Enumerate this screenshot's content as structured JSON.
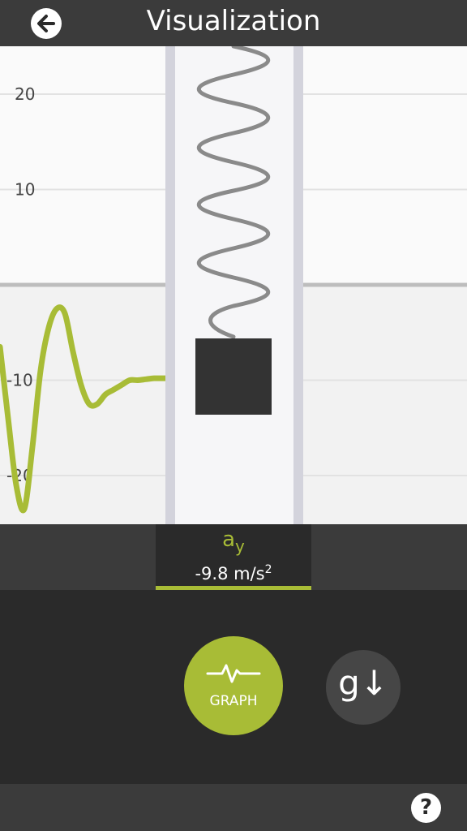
{
  "header": {
    "title": "Visualization",
    "back_icon": "arrow-left-icon"
  },
  "chart_data": {
    "type": "line",
    "y_tick_labels": [
      "20",
      "10",
      "-10",
      "-20"
    ],
    "y_ticks": [
      20,
      10,
      0,
      -10,
      -20
    ],
    "ylim": [
      -25,
      25
    ],
    "grid": true,
    "series": [
      {
        "color": "#a8bc36",
        "x": [
          0,
          0.5,
          1,
          1.5,
          2,
          2.5,
          3,
          3.5,
          4,
          4.5,
          5,
          5.5,
          6,
          6.5,
          7,
          7.5,
          8,
          8.5,
          9,
          9.5,
          10,
          10.5
        ],
        "values": [
          -6.5,
          -14,
          -21,
          -23.5,
          -17,
          -9,
          -4.5,
          -2.5,
          -3,
          -7,
          -10.5,
          -12.5,
          -12.5,
          -11.5,
          -11,
          -10.5,
          -10,
          -10,
          -9.9,
          -9.8,
          -9.8,
          -9.8
        ]
      }
    ]
  },
  "readout": {
    "symbol": "a",
    "subscript": "y",
    "value": "-9.8 m/s",
    "exponent": "2"
  },
  "buttons": {
    "graph_label": "GRAPH",
    "graph_icon": "graph-pulse-icon",
    "gravity_label": "g↓",
    "help_label": "?"
  },
  "colors": {
    "accent": "#a8bc36",
    "toolbar": "#3b3b3b",
    "background": "#2a2a2a"
  }
}
